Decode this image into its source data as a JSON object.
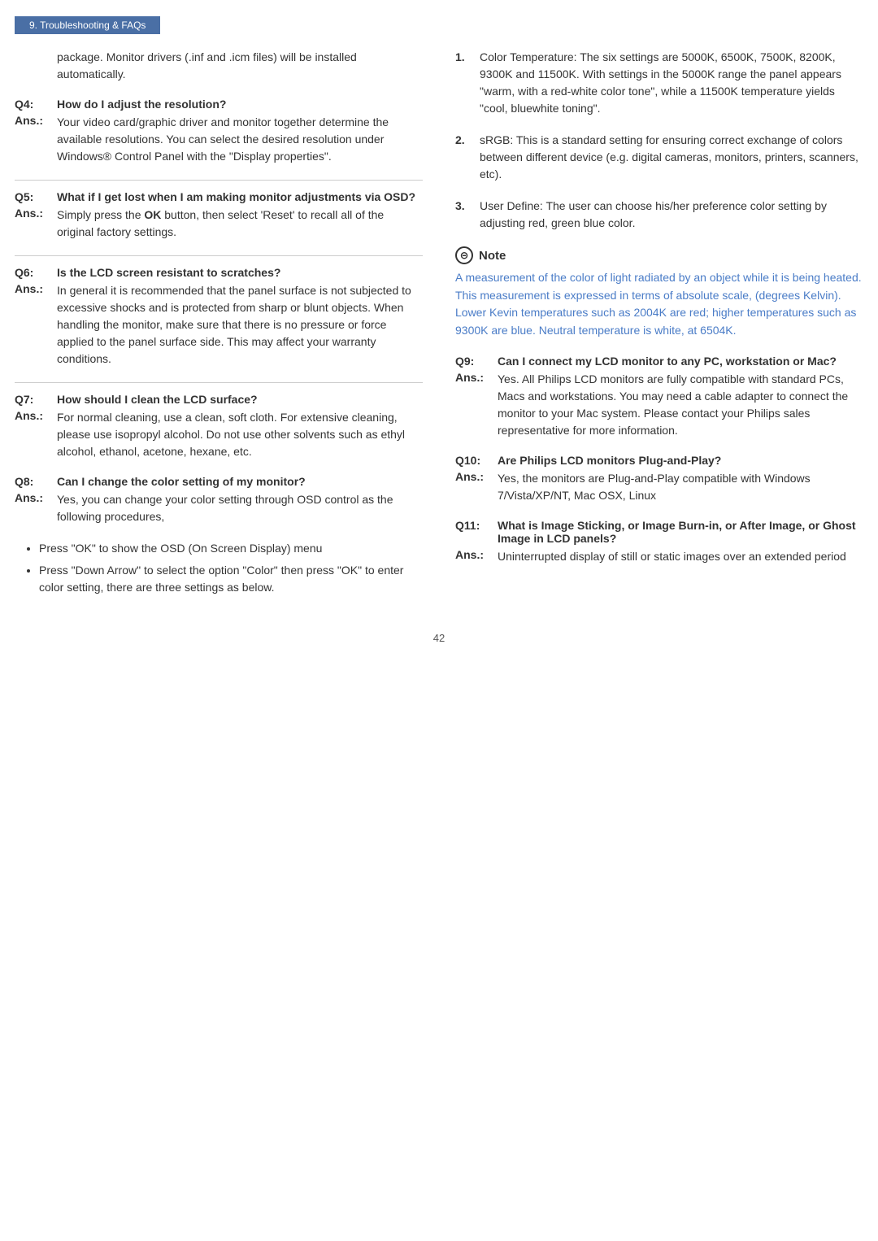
{
  "breadcrumb": "9. Troubleshooting & FAQs",
  "intro": {
    "text": "package. Monitor drivers (.inf and .icm files) will be installed automatically."
  },
  "left_column": {
    "qa": [
      {
        "id": "q4",
        "q_label": "Q4:",
        "q_text": "How do I adjust the resolution?",
        "a_label": "Ans.:",
        "a_text": "Your video card/graphic driver and monitor together determine the available resolutions. You can select the desired resolution under Windows® Control Panel with the \"Display properties\"."
      },
      {
        "id": "q5",
        "q_label": "Q5:",
        "q_text": "What if I get lost when I am making monitor adjustments via OSD?",
        "a_label": "Ans.:",
        "a_text_parts": [
          "Simply press the ",
          "OK",
          " button, then select 'Reset' to recall all of the original factory settings."
        ],
        "bold_word": "OK"
      },
      {
        "id": "q6",
        "q_label": "Q6:",
        "q_text": "Is the LCD screen resistant to scratches?",
        "a_label": "Ans.:",
        "a_text": "In general it is recommended that the panel surface is not subjected to excessive shocks and is protected from sharp or blunt objects. When handling the monitor, make sure that there is no pressure or force applied to the panel surface side. This may affect your warranty conditions."
      },
      {
        "id": "q7",
        "q_label": "Q7:",
        "q_text": "How should I clean the LCD surface?",
        "a_label": "Ans.:",
        "a_text": "For normal cleaning, use a clean, soft cloth. For extensive cleaning, please use isopropyl alcohol. Do not use other solvents such as ethyl alcohol, ethanol, acetone, hexane, etc."
      },
      {
        "id": "q8",
        "q_label": "Q8:",
        "q_text": "Can I change the color setting of my monitor?",
        "a_label": "Ans.:",
        "a_text": "Yes, you can change your color setting through OSD control as the following procedures,"
      }
    ],
    "bullets": [
      "Press \"OK\" to show the OSD (On Screen Display) menu",
      "Press \"Down Arrow\" to select the option \"Color\" then press \"OK\" to enter color setting, there are three settings as below."
    ]
  },
  "right_column": {
    "numbered_items": [
      {
        "num": "1.",
        "text": "Color Temperature: The six settings are 5000K, 6500K, 7500K, 8200K, 9300K and 11500K. With settings in the 5000K range the panel appears \"warm, with a red-white color tone\", while a 11500K temperature yields \"cool, bluewhite toning\"."
      },
      {
        "num": "2.",
        "text": "sRGB: This is a standard setting for ensuring correct exchange of colors between different device (e.g. digital cameras, monitors, printers, scanners, etc)."
      },
      {
        "num": "3.",
        "text": "User Define: The user can choose his/her preference color setting by adjusting red, green blue color."
      }
    ],
    "note": {
      "label": "Note",
      "icon": "⊖",
      "text": "A measurement of the color of light radiated by an object while it is being heated. This measurement is expressed in terms of absolute scale, (degrees Kelvin). Lower Kevin temperatures such as 2004K are red; higher temperatures such as 9300K are blue. Neutral temperature is white, at 6504K."
    },
    "qa": [
      {
        "id": "q9",
        "q_label": "Q9:",
        "q_text": "Can I connect my LCD monitor to any PC, workstation or Mac?",
        "a_label": "Ans.:",
        "a_text": "Yes. All Philips LCD monitors are fully compatible with standard PCs, Macs and workstations. You may need a cable adapter to connect the monitor to your Mac system. Please contact your Philips sales representative for more information."
      },
      {
        "id": "q10",
        "q_label": "Q10:",
        "q_text": "Are Philips LCD monitors Plug-and-Play?",
        "a_label": "Ans.:",
        "a_text": "Yes, the monitors are Plug-and-Play compatible with Windows 7/Vista/XP/NT, Mac OSX, Linux"
      },
      {
        "id": "q11",
        "q_label": "Q11:",
        "q_text": "What is Image Sticking, or Image Burn-in, or After Image, or Ghost Image in LCD panels?",
        "a_label": "Ans.:",
        "a_text": "Uninterrupted display of still or static images over an extended period"
      }
    ]
  },
  "page_number": "42"
}
